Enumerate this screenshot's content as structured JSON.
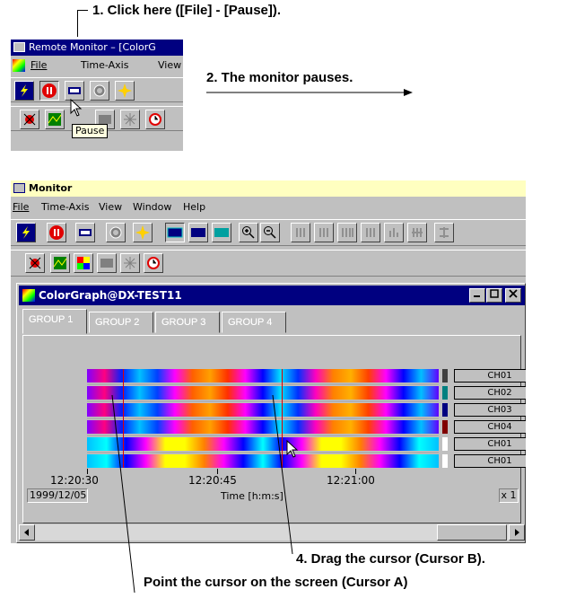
{
  "callouts": {
    "step1": "1. Click here ([File] - [Pause]).",
    "step2": "2. The monitor pauses.",
    "step4": "4. Drag the cursor (Cursor B).",
    "step_point": "Point the cursor on the screen (Cursor A)"
  },
  "small_window": {
    "title": "Remote Monitor – [ColorG",
    "menu": [
      "File",
      "Time-Axis",
      "View"
    ],
    "tooltip": "Pause"
  },
  "monitor": {
    "title": "Monitor",
    "menu": [
      "File",
      "Time-Axis",
      "View",
      "Window",
      "Help"
    ],
    "child_title": "ColorGraph@DX-TEST11",
    "tabs": [
      "GROUP 1",
      "GROUP 2",
      "GROUP 3",
      "GROUP 4"
    ],
    "active_tab": "GROUP 1",
    "channels": [
      {
        "label": "CH01",
        "color": "#404040"
      },
      {
        "label": "CH02",
        "color": "#008080"
      },
      {
        "label": "CH03",
        "color": "#000080"
      },
      {
        "label": "CH04",
        "color": "#800000"
      },
      {
        "label": "CH01",
        "color": "#ffffff"
      },
      {
        "label": "CH01",
        "color": "#ffffff"
      }
    ],
    "time_ticks": [
      "12:20:30",
      "12:20:45",
      "12:21:00"
    ],
    "date": "1999/12/05",
    "time_axis_label": "Time [h:m:s]",
    "zoom": "x 1"
  },
  "colors": {
    "titlebar_active": "#ffffc0",
    "child_titlebar": "#000080",
    "panel": "#c0c0c0"
  }
}
